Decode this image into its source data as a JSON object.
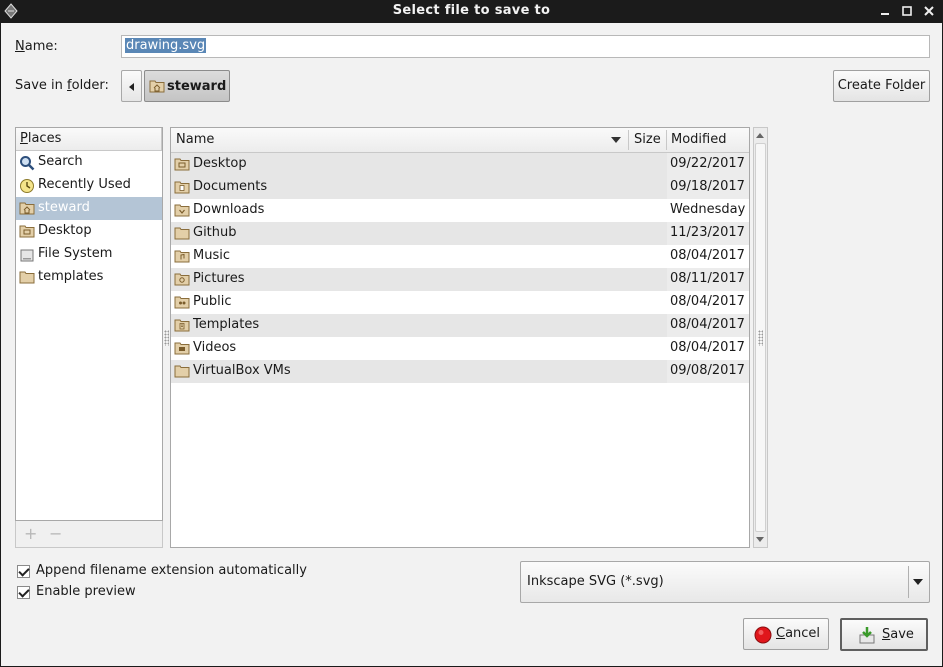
{
  "window": {
    "title": "Select file to save to"
  },
  "name_field": {
    "label_pre": "",
    "label_mnemonic": "N",
    "label_post": "ame:",
    "value": "drawing.svg"
  },
  "folder": {
    "label_pre": "Save in ",
    "label_mnemonic": "f",
    "label_post": "older:",
    "current": "steward"
  },
  "create_folder": {
    "pre": "Create Fo",
    "mnemonic": "l",
    "post": "der"
  },
  "places": {
    "header_mnemonic": "P",
    "header_rest": "laces",
    "items": [
      {
        "label": "Search",
        "icon": "search-icon"
      },
      {
        "label": "Recently Used",
        "icon": "recent-icon"
      },
      {
        "label": "steward",
        "icon": "home-folder-icon",
        "selected": true
      },
      {
        "label": "Desktop",
        "icon": "desktop-folder-icon"
      },
      {
        "label": "File System",
        "icon": "drive-icon"
      },
      {
        "label": "templates",
        "icon": "folder-icon"
      }
    ],
    "add": "+",
    "remove": "−"
  },
  "files": {
    "columns": {
      "name": "Name",
      "size": "Size",
      "modified": "Modified"
    },
    "rows": [
      {
        "name": "Desktop",
        "size": "",
        "modified": "09/22/2017",
        "icon": "desktop-folder-icon"
      },
      {
        "name": "Documents",
        "size": "",
        "modified": "09/18/2017",
        "icon": "documents-folder-icon"
      },
      {
        "name": "Downloads",
        "size": "",
        "modified": "Wednesday",
        "icon": "downloads-folder-icon"
      },
      {
        "name": "Github",
        "size": "",
        "modified": "11/23/2017",
        "icon": "folder-icon"
      },
      {
        "name": "Music",
        "size": "",
        "modified": "08/04/2017",
        "icon": "music-folder-icon"
      },
      {
        "name": "Pictures",
        "size": "",
        "modified": "08/11/2017",
        "icon": "pictures-folder-icon"
      },
      {
        "name": "Public",
        "size": "",
        "modified": "08/04/2017",
        "icon": "public-folder-icon"
      },
      {
        "name": "Templates",
        "size": "",
        "modified": "08/04/2017",
        "icon": "templates-folder-icon"
      },
      {
        "name": "Videos",
        "size": "",
        "modified": "08/04/2017",
        "icon": "videos-folder-icon"
      },
      {
        "name": "VirtualBox VMs",
        "size": "",
        "modified": "09/08/2017",
        "icon": "folder-icon"
      }
    ]
  },
  "options": {
    "append_ext": {
      "label": "Append filename extension automatically",
      "checked": true
    },
    "enable_preview": {
      "label": "Enable preview",
      "checked": true
    }
  },
  "filter": {
    "selected": "Inkscape SVG (*.svg)"
  },
  "buttons": {
    "cancel": {
      "mnemonic": "C",
      "rest": "ancel"
    },
    "save": {
      "mnemonic": "S",
      "rest": "ave"
    }
  },
  "colors": {
    "selection": "#5a87b6",
    "places_selected": "#b4c5d6",
    "titlebar": "#1b1b1b"
  }
}
